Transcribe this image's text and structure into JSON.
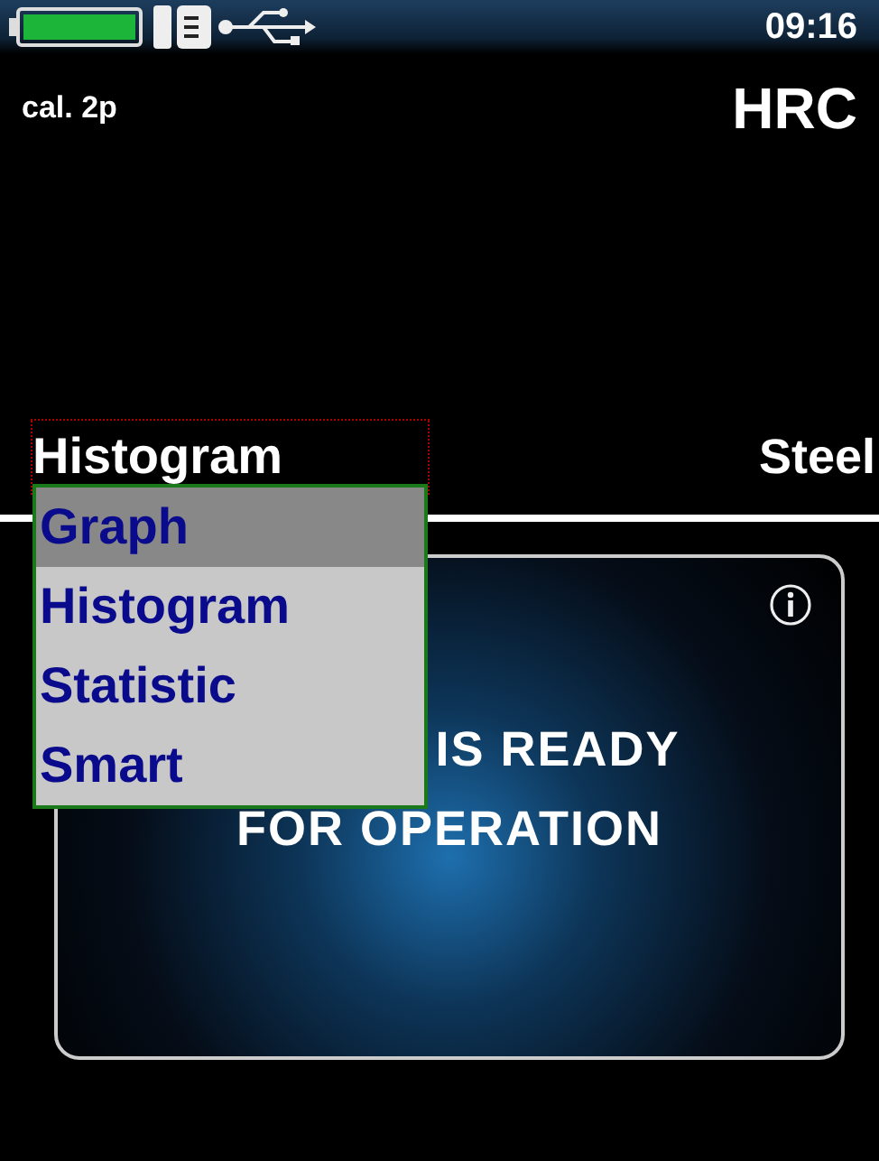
{
  "status_bar": {
    "time": "09:16"
  },
  "header": {
    "calibration": "cal. 2p",
    "scale": "HRC"
  },
  "mode_row": {
    "mode": "Histogram",
    "material": "Steel"
  },
  "dropdown": {
    "items": [
      {
        "label": "Graph",
        "selected": true
      },
      {
        "label": "Histogram",
        "selected": false
      },
      {
        "label": "Statistic",
        "selected": false
      },
      {
        "label": "Smart",
        "selected": false
      }
    ]
  },
  "message": {
    "lines": [
      "IS READY",
      "FOR OPERATION"
    ]
  }
}
